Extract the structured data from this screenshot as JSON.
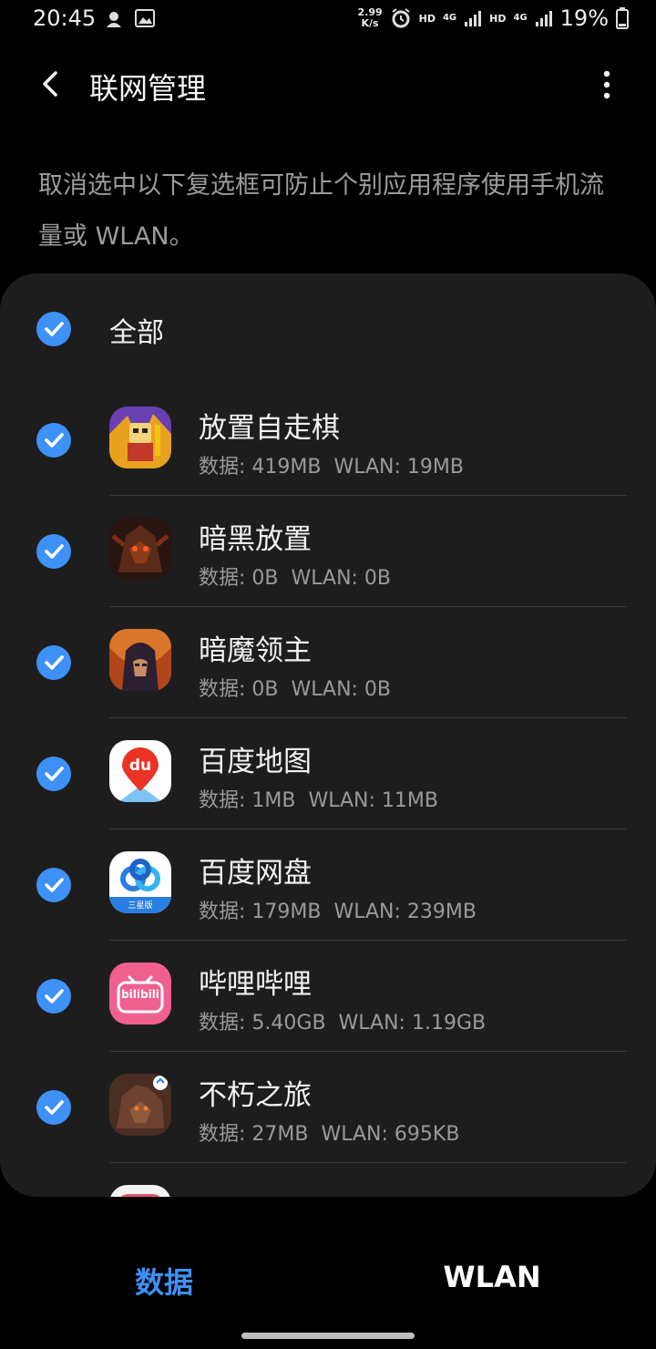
{
  "status_bar": {
    "time": "20:45",
    "speed_value": "2.99",
    "speed_unit": "K/s",
    "hd1": "HD",
    "hd2": "HD",
    "net1": "4G",
    "net2": "4G",
    "battery": "19%",
    "icons": [
      "notification-icon",
      "gallery-icon",
      "alarm-icon",
      "signal-icon",
      "battery-icon"
    ]
  },
  "header": {
    "title": "联网管理"
  },
  "description": "取消选中以下复选框可防止个别应用程序使用手机流量或 WLAN。",
  "all": {
    "label": "全部",
    "checked": true
  },
  "apps": [
    {
      "name": "放置自走棋",
      "data": "数据: 419MB",
      "wlan": "WLAN: 19MB",
      "checked": true
    },
    {
      "name": "暗黑放置",
      "data": "数据: 0B",
      "wlan": "WLAN: 0B",
      "checked": true
    },
    {
      "name": "暗魔领主",
      "data": "数据: 0B",
      "wlan": "WLAN: 0B",
      "checked": true
    },
    {
      "name": "百度地图",
      "data": "数据: 1MB",
      "wlan": "WLAN: 11MB",
      "checked": true,
      "icon_text": "du"
    },
    {
      "name": "百度网盘",
      "data": "数据: 179MB",
      "wlan": "WLAN: 239MB",
      "checked": true,
      "icon_text": "三星版"
    },
    {
      "name": "哔哩哔哩",
      "data": "数据: 5.40GB",
      "wlan": "WLAN: 1.19GB",
      "checked": true,
      "icon_text": "bilibili"
    },
    {
      "name": "不朽之旅",
      "data": "数据: 27MB",
      "wlan": "WLAN: 695KB",
      "checked": true
    }
  ],
  "tabs": {
    "data": "数据",
    "wlan": "WLAN"
  },
  "colors": {
    "accent": "#3e91f7",
    "card": "#1d1d1d",
    "background": "#000000"
  }
}
